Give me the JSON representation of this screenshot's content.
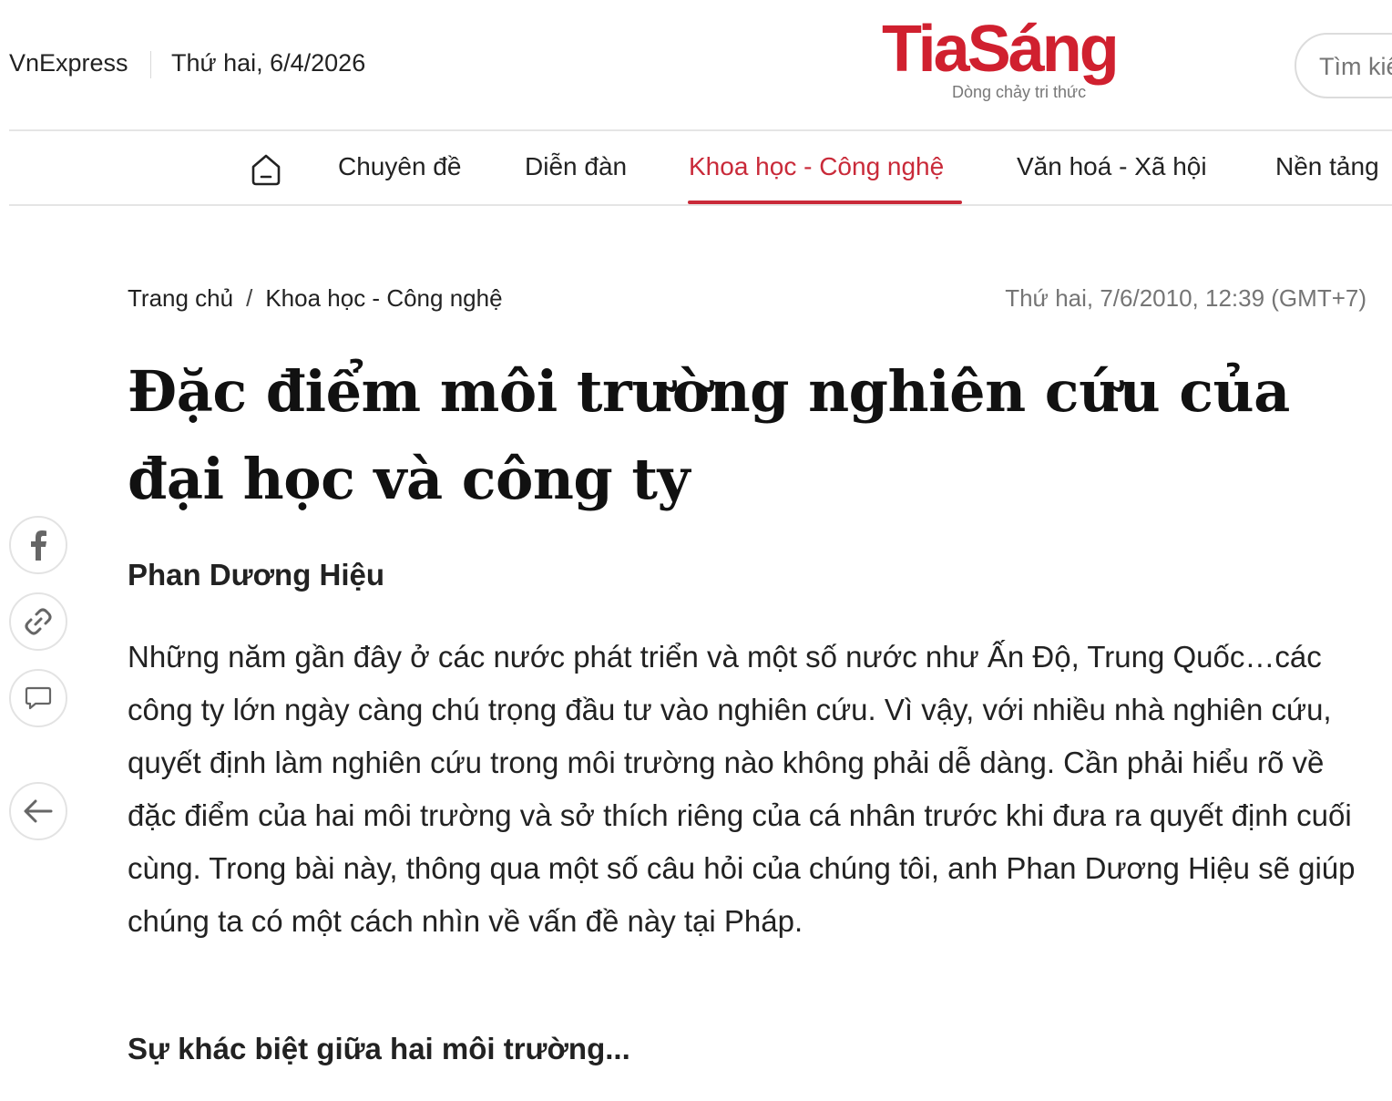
{
  "header": {
    "brand": "VnExpress",
    "date": "Thứ hai, 6/4/2026",
    "logo_text": "TiaSáng",
    "logo_tagline": "Dòng chảy tri thức",
    "search_placeholder": "Tìm kiếm"
  },
  "nav": {
    "home_icon": "home-icon",
    "items": [
      {
        "label": "Chuyên đề"
      },
      {
        "label": "Diễn đàn"
      },
      {
        "label": "Khoa học - Công nghệ",
        "active": true
      },
      {
        "label": "Văn hoá - Xã hội"
      },
      {
        "label": "Nền tảng"
      }
    ],
    "active_color": "#c92a39"
  },
  "breadcrumb": {
    "home": "Trang chủ",
    "separator": "/",
    "category": "Khoa học - Công nghệ"
  },
  "article": {
    "published": "Thứ hai, 7/6/2010, 12:39 (GMT+7)",
    "title": "Đặc điểm môi trường nghiên cứu của đại học và công ty",
    "author": "Phan Dương Hiệu",
    "lead": "Những năm gần đây ở các nước phát triển và một số nước như Ấn Độ, Trung Quốc…các công ty lớn ngày càng chú trọng đầu tư vào nghiên cứu. Vì vậy, với nhiều nhà nghiên cứu, quyết định làm nghiên cứu trong môi trường nào không phải dễ dàng. Cần phải hiểu rõ về đặc điểm của hai môi trường và sở thích riêng của cá nhân trước khi đưa ra quyết định cuối cùng. Trong bài này, thông qua một số câu hỏi của chúng tôi, anh Phan Dương Hiệu sẽ giúp chúng ta có một cách nhìn về vấn đề này tại Pháp.",
    "subheading": "Sự khác biệt giữa hai môi trường..."
  },
  "share_rail": {
    "icons": [
      "facebook-icon",
      "link-icon",
      "comment-icon",
      "back-arrow-icon"
    ]
  },
  "colors": {
    "accent": "#c92a39",
    "logo_red": "#d0202f",
    "muted_text": "#757575",
    "divider": "#e5e5e5"
  }
}
